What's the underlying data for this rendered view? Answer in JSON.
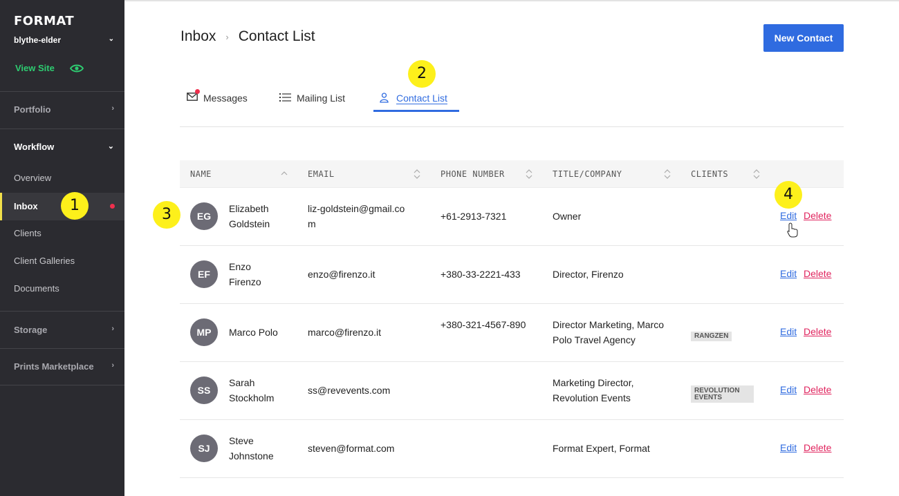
{
  "sidebar": {
    "logo": "FORMAT",
    "account": "blythe-elder",
    "view_site": "View Site",
    "sections": {
      "portfolio": "Portfolio",
      "workflow": "Workflow",
      "storage": "Storage",
      "prints": "Prints Marketplace"
    },
    "items": [
      {
        "label": "Overview"
      },
      {
        "label": "Inbox"
      },
      {
        "label": "Clients"
      },
      {
        "label": "Client Galleries"
      },
      {
        "label": "Documents"
      }
    ]
  },
  "header": {
    "crumb_parent": "Inbox",
    "crumb_current": "Contact List",
    "new_contact": "New Contact"
  },
  "tabs": [
    {
      "label": "Messages"
    },
    {
      "label": "Mailing List"
    },
    {
      "label": "Contact List"
    }
  ],
  "table": {
    "columns": [
      "NAME",
      "EMAIL",
      "PHONE NUMBER",
      "TITLE/COMPANY",
      "CLIENTS"
    ],
    "edit_label": "Edit",
    "delete_label": "Delete",
    "rows": [
      {
        "initials": "EG",
        "name": "Elizabeth Goldstein",
        "email": "liz-goldstein@gmail.com",
        "phone": "+61-2913-7321",
        "title": "Owner",
        "client": ""
      },
      {
        "initials": "EF",
        "name": "Enzo Firenzo",
        "email": "enzo@firenzo.it",
        "phone": "+380-33-2221-433",
        "title": "Director, Firenzo",
        "client": ""
      },
      {
        "initials": "MP",
        "name": "Marco Polo",
        "email": "marco@firenzo.it",
        "phone": "+380-321-4567-890",
        "title": "Director Marketing, Marco Polo Travel Agency",
        "client": "RANGZEN"
      },
      {
        "initials": "SS",
        "name": "Sarah Stockholm",
        "email": "ss@revevents.com",
        "phone": "",
        "title": "Marketing Director, Revolution Events",
        "client": "REVOLUTION EVENTS"
      },
      {
        "initials": "SJ",
        "name": "Steve Johnstone",
        "email": "steven@format.com",
        "phone": "",
        "title": "Format Expert, Format",
        "client": ""
      }
    ]
  },
  "markers": [
    "1",
    "2",
    "3",
    "4"
  ],
  "colors": {
    "sidebar_bg": "#2b2b30",
    "accent_blue": "#2f6be0",
    "delete_red": "#e0245e",
    "view_site_green": "#2ecc71",
    "marker_yellow": "#fdf01b",
    "notification_red": "#ef2f4d"
  }
}
